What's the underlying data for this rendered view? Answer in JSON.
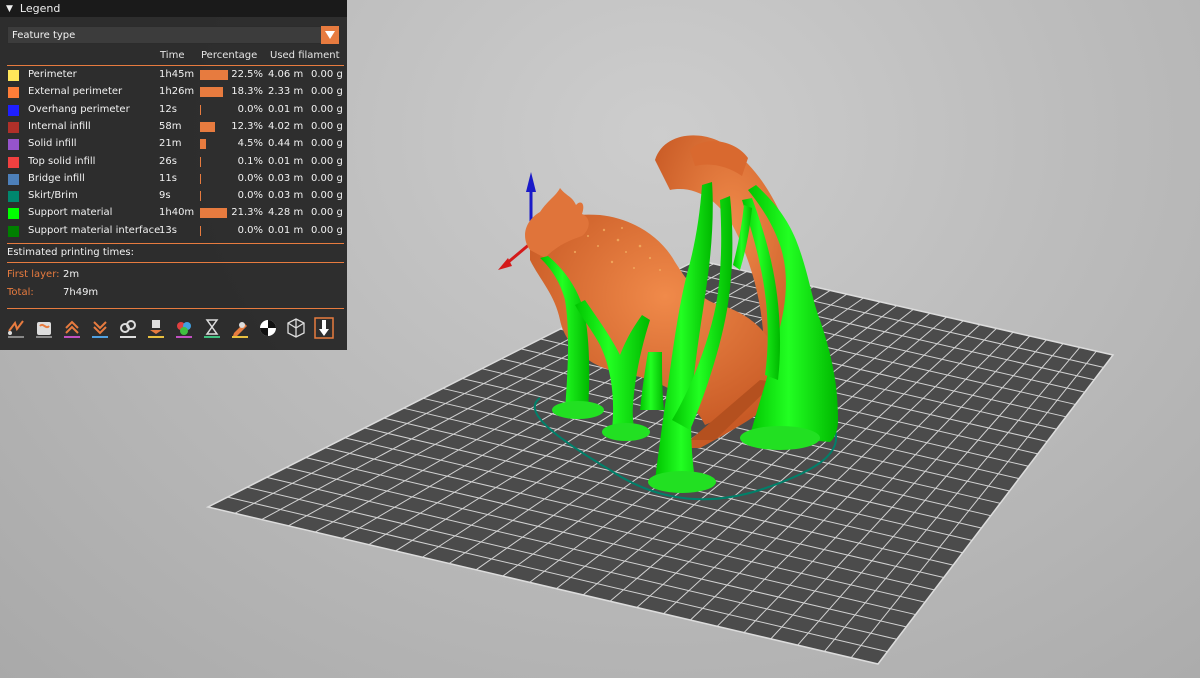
{
  "legend": {
    "title": "Legend",
    "view_type": "Feature type",
    "columns": {
      "time": "Time",
      "percentage": "Percentage",
      "used_filament": "Used filament"
    },
    "features": [
      {
        "name": "Perimeter",
        "color": "#FFE65A",
        "time": "1h45m",
        "percent": "22.5%",
        "percent_value": 22.5,
        "length": "4.06 m",
        "weight": "0.00 g"
      },
      {
        "name": "External perimeter",
        "color": "#FF7D38",
        "time": "1h26m",
        "percent": "18.3%",
        "percent_value": 18.3,
        "length": "2.33 m",
        "weight": "0.00 g"
      },
      {
        "name": "Overhang perimeter",
        "color": "#1F1FFF",
        "time": "12s",
        "percent": "0.0%",
        "percent_value": 0.0,
        "length": "0.01 m",
        "weight": "0.00 g"
      },
      {
        "name": "Internal infill",
        "color": "#B03029",
        "time": "58m",
        "percent": "12.3%",
        "percent_value": 12.3,
        "length": "4.02 m",
        "weight": "0.00 g"
      },
      {
        "name": "Solid infill",
        "color": "#9654CC",
        "time": "21m",
        "percent": "4.5%",
        "percent_value": 4.5,
        "length": "0.44 m",
        "weight": "0.00 g"
      },
      {
        "name": "Top solid infill",
        "color": "#F04040",
        "time": "26s",
        "percent": "0.1%",
        "percent_value": 0.1,
        "length": "0.01 m",
        "weight": "0.00 g"
      },
      {
        "name": "Bridge infill",
        "color": "#4D80BA",
        "time": "11s",
        "percent": "0.0%",
        "percent_value": 0.0,
        "length": "0.03 m",
        "weight": "0.00 g"
      },
      {
        "name": "Skirt/Brim",
        "color": "#00876E",
        "time": "9s",
        "percent": "0.0%",
        "percent_value": 0.0,
        "length": "0.03 m",
        "weight": "0.00 g"
      },
      {
        "name": "Support material",
        "color": "#00FF00",
        "time": "1h40m",
        "percent": "21.3%",
        "percent_value": 21.3,
        "length": "4.28 m",
        "weight": "0.00 g"
      },
      {
        "name": "Support material interface",
        "color": "#008000",
        "time": "13s",
        "percent": "0.0%",
        "percent_value": 0.0,
        "length": "0.01 m",
        "weight": "0.00 g"
      }
    ],
    "estimated_title": "Estimated printing times:",
    "first_layer_label": "First layer:",
    "first_layer_value": "2m",
    "total_label": "Total:",
    "total_value": "7h49m",
    "toolbar": [
      {
        "icon": "travel-icon"
      },
      {
        "icon": "wipe-icon"
      },
      {
        "icon": "retractions-icon"
      },
      {
        "icon": "deretractions-icon"
      },
      {
        "icon": "seams-icon"
      },
      {
        "icon": "tool-changes-icon"
      },
      {
        "icon": "color-changes-icon"
      },
      {
        "icon": "pause-prints-icon"
      },
      {
        "icon": "custom-gcodes-icon"
      },
      {
        "icon": "center-of-gravity-icon"
      },
      {
        "icon": "shells-icon"
      },
      {
        "icon": "tool-marker-icon"
      }
    ]
  }
}
